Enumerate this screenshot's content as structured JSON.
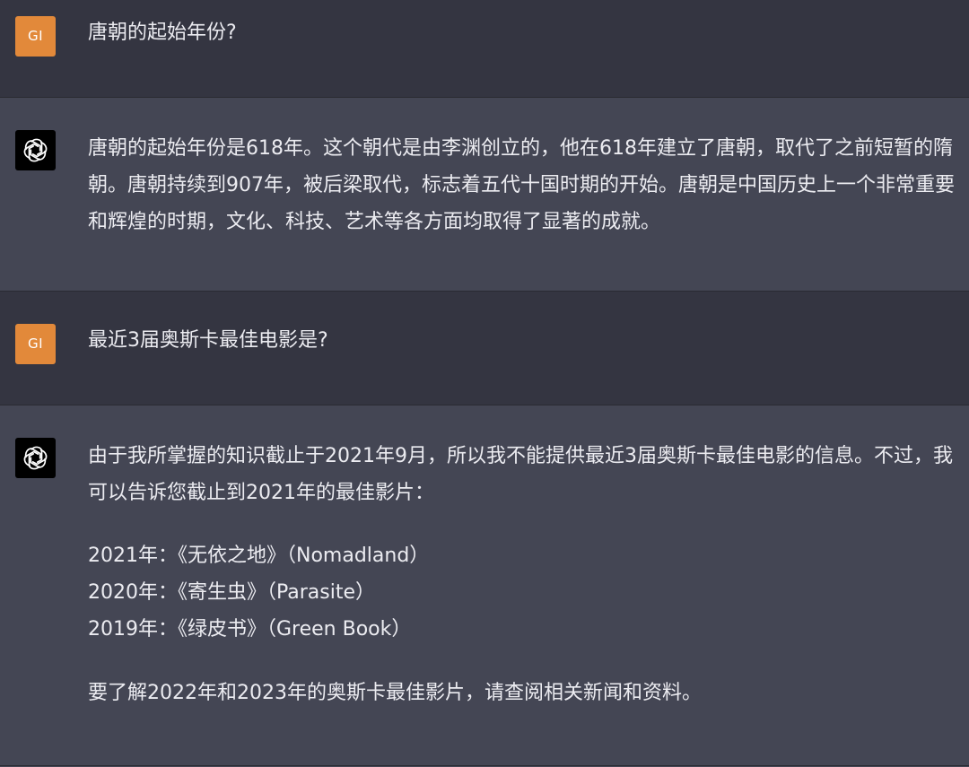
{
  "conversation": [
    {
      "role": "user",
      "avatar_initials": "GI",
      "text": "唐朝的起始年份?"
    },
    {
      "role": "assistant",
      "avatar_icon": "openai-logo-icon",
      "text": "唐朝的起始年份是618年。这个朝代是由李渊创立的，他在618年建立了唐朝，取代了之前短暂的隋朝。唐朝持续到907年，被后梁取代，标志着五代十国时期的开始。唐朝是中国历史上一个非常重要和辉煌的时期，文化、科技、艺术等各方面均取得了显著的成就。"
    },
    {
      "role": "user",
      "avatar_initials": "GI",
      "text": "最近3届奥斯卡最佳电影是?"
    },
    {
      "role": "assistant",
      "avatar_icon": "openai-logo-icon",
      "intro": "由于我所掌握的知识截止于2021年9月，所以我不能提供最近3届奥斯卡最佳电影的信息。不过，我可以告诉您截止到2021年的最佳影片：",
      "list": [
        "2021年：《无依之地》（Nomadland）",
        "2020年：《寄生虫》（Parasite）",
        "2019年：《绿皮书》（Green Book）"
      ],
      "outro": "要了解2022年和2023年的奥斯卡最佳影片，请查阅相关新闻和资料。"
    }
  ],
  "colors": {
    "user_bg": "#343541",
    "assistant_bg": "#444654",
    "user_avatar": "#e2893a",
    "text": "#ececf1"
  }
}
